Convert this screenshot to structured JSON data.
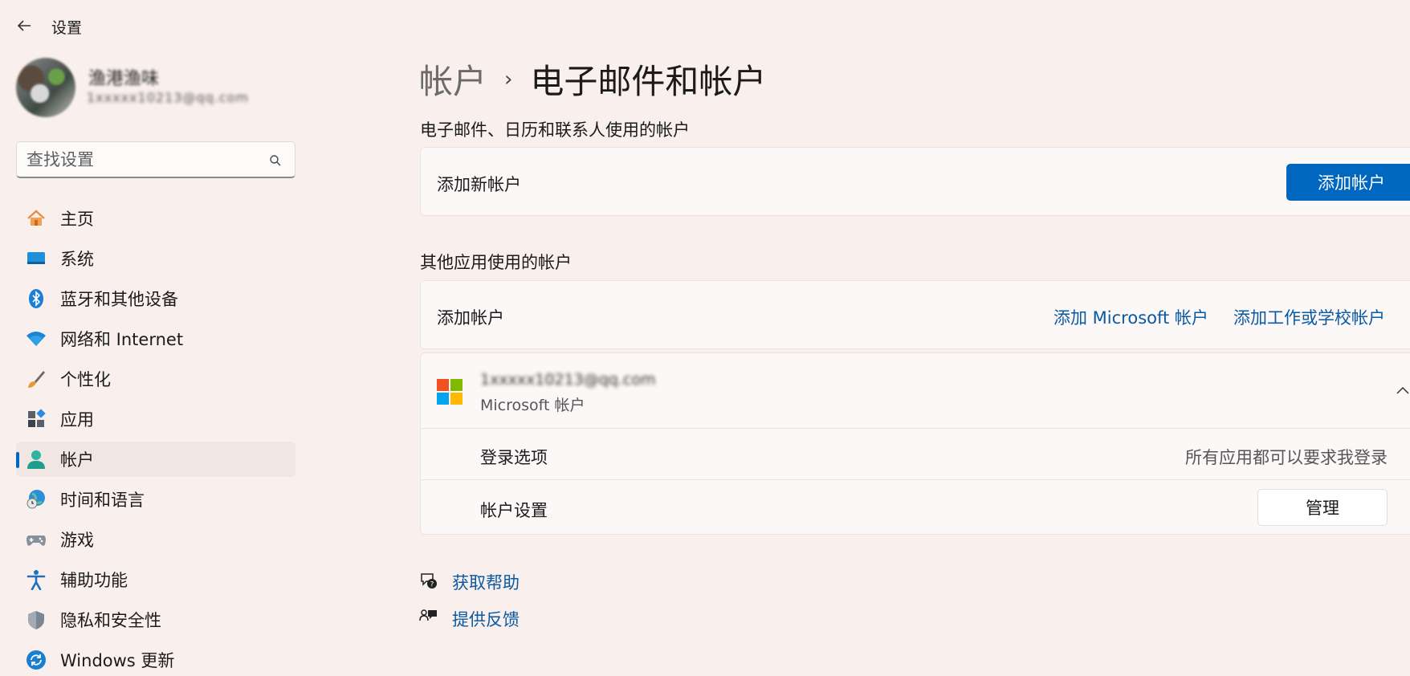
{
  "app": {
    "title": "设置"
  },
  "user": {
    "name": "渔港渔味",
    "email": "1xxxxx10213@qq.com"
  },
  "search": {
    "placeholder": "查找设置"
  },
  "sidebar": {
    "items": [
      {
        "label": "主页",
        "icon": "home-icon"
      },
      {
        "label": "系统",
        "icon": "system-icon"
      },
      {
        "label": "蓝牙和其他设备",
        "icon": "bluetooth-icon"
      },
      {
        "label": "网络和 Internet",
        "icon": "wifi-icon"
      },
      {
        "label": "个性化",
        "icon": "brush-icon"
      },
      {
        "label": "应用",
        "icon": "apps-icon"
      },
      {
        "label": "帐户",
        "icon": "account-icon",
        "active": true
      },
      {
        "label": "时间和语言",
        "icon": "globe-clock-icon"
      },
      {
        "label": "游戏",
        "icon": "gamepad-icon"
      },
      {
        "label": "辅助功能",
        "icon": "accessibility-icon"
      },
      {
        "label": "隐私和安全性",
        "icon": "shield-icon"
      },
      {
        "label": "Windows 更新",
        "icon": "update-icon"
      }
    ]
  },
  "breadcrumb": {
    "parent": "帐户",
    "separator": "›",
    "current": "电子邮件和帐户"
  },
  "email_section": {
    "title": "电子邮件、日历和联系人使用的帐户",
    "add_new_label": "添加新帐户",
    "add_button": "添加帐户"
  },
  "other_section": {
    "title": "其他应用使用的帐户",
    "add_label": "添加帐户",
    "add_microsoft_link": "添加 Microsoft 帐户",
    "add_work_link": "添加工作或学校帐户"
  },
  "account": {
    "email": "1xxxxx10213@qq.com",
    "type": "Microsoft 帐户",
    "signin_options_label": "登录选项",
    "signin_options_value": "所有应用都可以要求我登录",
    "settings_label": "帐户设置",
    "manage_button": "管理"
  },
  "help": {
    "get_help": "获取帮助",
    "feedback": "提供反馈"
  },
  "colors": {
    "accent": "#0067c0",
    "link": "#0a5aa3",
    "background": "#f9efec"
  }
}
